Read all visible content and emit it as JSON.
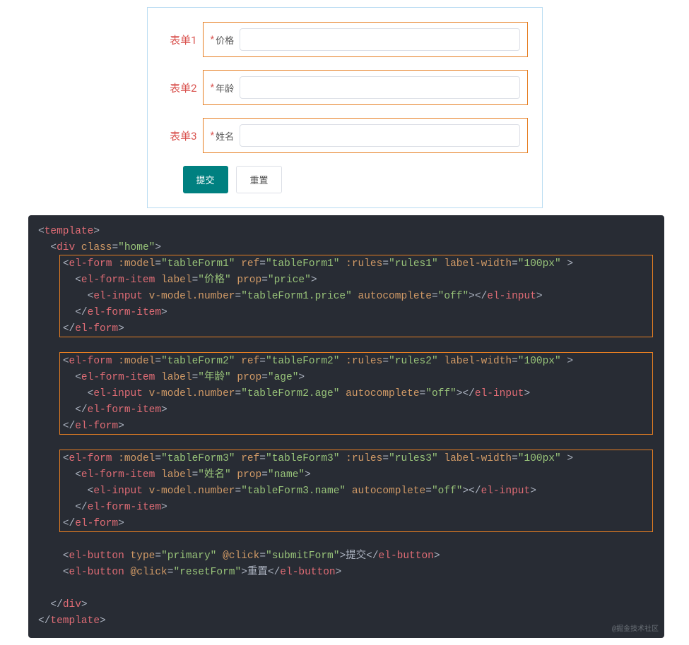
{
  "form": {
    "rows": [
      {
        "row_label": "表单1",
        "field_label": "价格",
        "required": "*"
      },
      {
        "row_label": "表单2",
        "field_label": "年龄",
        "required": "*"
      },
      {
        "row_label": "表单3",
        "field_label": "姓名",
        "required": "*"
      }
    ],
    "submit_label": "提交",
    "reset_label": "重置"
  },
  "code": {
    "lines": [
      {
        "ind": 0,
        "parts": [
          [
            "punc",
            "<"
          ],
          [
            "tag",
            "template"
          ],
          [
            "punc",
            ">"
          ]
        ]
      },
      {
        "ind": 1,
        "parts": [
          [
            "punc",
            "<"
          ],
          [
            "tag",
            "div"
          ],
          [
            "text",
            " "
          ],
          [
            "attr",
            "class"
          ],
          [
            "punc",
            "="
          ],
          [
            "str",
            "\"home\""
          ],
          [
            "punc",
            ">"
          ]
        ]
      },
      {
        "ind": 2,
        "parts": [
          [
            "punc",
            "<"
          ],
          [
            "tag",
            "el-form"
          ],
          [
            "text",
            " "
          ],
          [
            "attr",
            ":model"
          ],
          [
            "punc",
            "="
          ],
          [
            "str",
            "\"tableForm1\""
          ],
          [
            "text",
            " "
          ],
          [
            "attr",
            "ref"
          ],
          [
            "punc",
            "="
          ],
          [
            "str",
            "\"tableForm1\""
          ],
          [
            "text",
            " "
          ],
          [
            "attr",
            ":rules"
          ],
          [
            "punc",
            "="
          ],
          [
            "str",
            "\"rules1\""
          ],
          [
            "text",
            " "
          ],
          [
            "attr",
            "label-width"
          ],
          [
            "punc",
            "="
          ],
          [
            "str",
            "\"100px\""
          ],
          [
            "text",
            " "
          ],
          [
            "punc",
            ">"
          ]
        ]
      },
      {
        "ind": 3,
        "parts": [
          [
            "punc",
            "<"
          ],
          [
            "tag",
            "el-form-item"
          ],
          [
            "text",
            " "
          ],
          [
            "attr",
            "label"
          ],
          [
            "punc",
            "="
          ],
          [
            "str",
            "\"价格\""
          ],
          [
            "text",
            " "
          ],
          [
            "attr",
            "prop"
          ],
          [
            "punc",
            "="
          ],
          [
            "str",
            "\"price\""
          ],
          [
            "punc",
            ">"
          ]
        ]
      },
      {
        "ind": 4,
        "parts": [
          [
            "punc",
            "<"
          ],
          [
            "tag",
            "el-input"
          ],
          [
            "text",
            " "
          ],
          [
            "attr",
            "v-model.number"
          ],
          [
            "punc",
            "="
          ],
          [
            "str",
            "\"tableForm1.price\""
          ],
          [
            "text",
            " "
          ],
          [
            "attr",
            "autocomplete"
          ],
          [
            "punc",
            "="
          ],
          [
            "str",
            "\"off\""
          ],
          [
            "punc",
            "></"
          ],
          [
            "tag",
            "el-input"
          ],
          [
            "punc",
            ">"
          ]
        ]
      },
      {
        "ind": 3,
        "parts": [
          [
            "punc",
            "</"
          ],
          [
            "tag",
            "el-form-item"
          ],
          [
            "punc",
            ">"
          ]
        ]
      },
      {
        "ind": 2,
        "parts": [
          [
            "punc",
            "</"
          ],
          [
            "tag",
            "el-form"
          ],
          [
            "punc",
            ">"
          ]
        ]
      },
      {
        "ind": 0,
        "parts": []
      },
      {
        "ind": 2,
        "parts": [
          [
            "punc",
            "<"
          ],
          [
            "tag",
            "el-form"
          ],
          [
            "text",
            " "
          ],
          [
            "attr",
            ":model"
          ],
          [
            "punc",
            "="
          ],
          [
            "str",
            "\"tableForm2\""
          ],
          [
            "text",
            " "
          ],
          [
            "attr",
            "ref"
          ],
          [
            "punc",
            "="
          ],
          [
            "str",
            "\"tableForm2\""
          ],
          [
            "text",
            " "
          ],
          [
            "attr",
            ":rules"
          ],
          [
            "punc",
            "="
          ],
          [
            "str",
            "\"rules2\""
          ],
          [
            "text",
            " "
          ],
          [
            "attr",
            "label-width"
          ],
          [
            "punc",
            "="
          ],
          [
            "str",
            "\"100px\""
          ],
          [
            "text",
            " "
          ],
          [
            "punc",
            ">"
          ]
        ]
      },
      {
        "ind": 3,
        "parts": [
          [
            "punc",
            "<"
          ],
          [
            "tag",
            "el-form-item"
          ],
          [
            "text",
            " "
          ],
          [
            "attr",
            "label"
          ],
          [
            "punc",
            "="
          ],
          [
            "str",
            "\"年龄\""
          ],
          [
            "text",
            " "
          ],
          [
            "attr",
            "prop"
          ],
          [
            "punc",
            "="
          ],
          [
            "str",
            "\"age\""
          ],
          [
            "punc",
            ">"
          ]
        ]
      },
      {
        "ind": 4,
        "parts": [
          [
            "punc",
            "<"
          ],
          [
            "tag",
            "el-input"
          ],
          [
            "text",
            " "
          ],
          [
            "attr",
            "v-model.number"
          ],
          [
            "punc",
            "="
          ],
          [
            "str",
            "\"tableForm2.age\""
          ],
          [
            "text",
            " "
          ],
          [
            "attr",
            "autocomplete"
          ],
          [
            "punc",
            "="
          ],
          [
            "str",
            "\"off\""
          ],
          [
            "punc",
            "></"
          ],
          [
            "tag",
            "el-input"
          ],
          [
            "punc",
            ">"
          ]
        ]
      },
      {
        "ind": 3,
        "parts": [
          [
            "punc",
            "</"
          ],
          [
            "tag",
            "el-form-item"
          ],
          [
            "punc",
            ">"
          ]
        ]
      },
      {
        "ind": 2,
        "parts": [
          [
            "punc",
            "</"
          ],
          [
            "tag",
            "el-form"
          ],
          [
            "punc",
            ">"
          ]
        ]
      },
      {
        "ind": 0,
        "parts": []
      },
      {
        "ind": 2,
        "parts": [
          [
            "punc",
            "<"
          ],
          [
            "tag",
            "el-form"
          ],
          [
            "text",
            " "
          ],
          [
            "attr",
            ":model"
          ],
          [
            "punc",
            "="
          ],
          [
            "str",
            "\"tableForm3\""
          ],
          [
            "text",
            " "
          ],
          [
            "attr",
            "ref"
          ],
          [
            "punc",
            "="
          ],
          [
            "str",
            "\"tableForm3\""
          ],
          [
            "text",
            " "
          ],
          [
            "attr",
            ":rules"
          ],
          [
            "punc",
            "="
          ],
          [
            "str",
            "\"rules3\""
          ],
          [
            "text",
            " "
          ],
          [
            "attr",
            "label-width"
          ],
          [
            "punc",
            "="
          ],
          [
            "str",
            "\"100px\""
          ],
          [
            "text",
            " "
          ],
          [
            "punc",
            ">"
          ]
        ]
      },
      {
        "ind": 3,
        "parts": [
          [
            "punc",
            "<"
          ],
          [
            "tag",
            "el-form-item"
          ],
          [
            "text",
            " "
          ],
          [
            "attr",
            "label"
          ],
          [
            "punc",
            "="
          ],
          [
            "str",
            "\"姓名\""
          ],
          [
            "text",
            " "
          ],
          [
            "attr",
            "prop"
          ],
          [
            "punc",
            "="
          ],
          [
            "str",
            "\"name\""
          ],
          [
            "punc",
            ">"
          ]
        ]
      },
      {
        "ind": 4,
        "parts": [
          [
            "punc",
            "<"
          ],
          [
            "tag",
            "el-input"
          ],
          [
            "text",
            " "
          ],
          [
            "attr",
            "v-model.number"
          ],
          [
            "punc",
            "="
          ],
          [
            "str",
            "\"tableForm3.name\""
          ],
          [
            "text",
            " "
          ],
          [
            "attr",
            "autocomplete"
          ],
          [
            "punc",
            "="
          ],
          [
            "str",
            "\"off\""
          ],
          [
            "punc",
            "></"
          ],
          [
            "tag",
            "el-input"
          ],
          [
            "punc",
            ">"
          ]
        ]
      },
      {
        "ind": 3,
        "parts": [
          [
            "punc",
            "</"
          ],
          [
            "tag",
            "el-form-item"
          ],
          [
            "punc",
            ">"
          ]
        ]
      },
      {
        "ind": 2,
        "parts": [
          [
            "punc",
            "</"
          ],
          [
            "tag",
            "el-form"
          ],
          [
            "punc",
            ">"
          ]
        ]
      },
      {
        "ind": 0,
        "parts": []
      },
      {
        "ind": 2,
        "parts": [
          [
            "punc",
            "<"
          ],
          [
            "tag",
            "el-button"
          ],
          [
            "text",
            " "
          ],
          [
            "attr",
            "type"
          ],
          [
            "punc",
            "="
          ],
          [
            "str",
            "\"primary\""
          ],
          [
            "text",
            " "
          ],
          [
            "attr",
            "@click"
          ],
          [
            "punc",
            "="
          ],
          [
            "str",
            "\"submitForm\""
          ],
          [
            "punc",
            ">"
          ],
          [
            "text",
            "提交"
          ],
          [
            "punc",
            "</"
          ],
          [
            "tag",
            "el-button"
          ],
          [
            "punc",
            ">"
          ]
        ]
      },
      {
        "ind": 2,
        "parts": [
          [
            "punc",
            "<"
          ],
          [
            "tag",
            "el-button"
          ],
          [
            "text",
            " "
          ],
          [
            "attr",
            "@click"
          ],
          [
            "punc",
            "="
          ],
          [
            "str",
            "\"resetForm\""
          ],
          [
            "punc",
            ">"
          ],
          [
            "text",
            "重置"
          ],
          [
            "punc",
            "</"
          ],
          [
            "tag",
            "el-button"
          ],
          [
            "punc",
            ">"
          ]
        ]
      },
      {
        "ind": 0,
        "parts": []
      },
      {
        "ind": 1,
        "parts": [
          [
            "punc",
            "</"
          ],
          [
            "tag",
            "div"
          ],
          [
            "punc",
            ">"
          ]
        ]
      },
      {
        "ind": 0,
        "parts": [
          [
            "punc",
            "</"
          ],
          [
            "tag",
            "template"
          ],
          [
            "punc",
            ">"
          ]
        ]
      }
    ],
    "highlights": [
      {
        "start": 2,
        "end": 6
      },
      {
        "start": 8,
        "end": 12
      },
      {
        "start": 14,
        "end": 18
      }
    ]
  },
  "watermark": "@掘金技术社区"
}
